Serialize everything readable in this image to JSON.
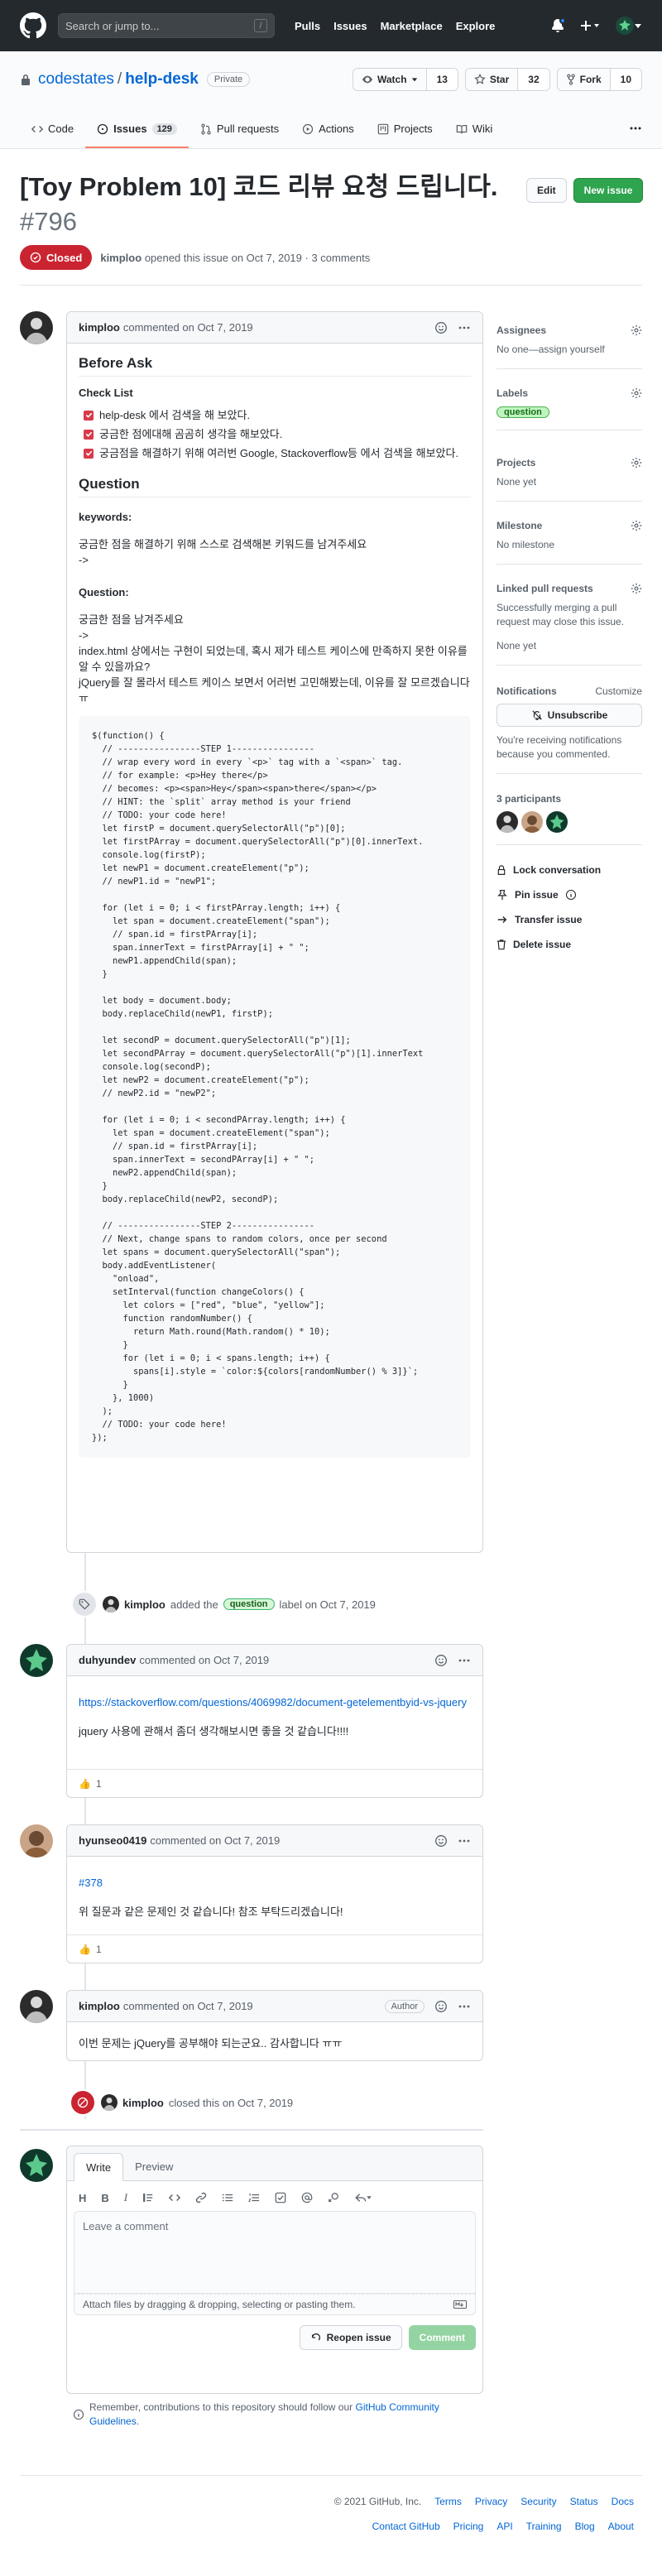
{
  "topbar": {
    "search_placeholder": "Search or jump to...",
    "search_shortcut": "/",
    "nav": [
      "Pulls",
      "Issues",
      "Marketplace",
      "Explore"
    ]
  },
  "repo": {
    "owner": "codestates",
    "separator": "/",
    "name": "help-desk",
    "visibility": "Private",
    "watch_label": "Watch",
    "watch_count": "13",
    "star_label": "Star",
    "star_count": "32",
    "fork_label": "Fork",
    "fork_count": "10",
    "tabs": [
      {
        "label": "Code",
        "icon": "code-icon"
      },
      {
        "label": "Issues",
        "icon": "issue-icon",
        "count": "129",
        "active": true
      },
      {
        "label": "Pull requests",
        "icon": "pull-request-icon"
      },
      {
        "label": "Actions",
        "icon": "play-icon"
      },
      {
        "label": "Projects",
        "icon": "project-icon"
      },
      {
        "label": "Wiki",
        "icon": "book-icon"
      }
    ]
  },
  "issue": {
    "title": "[Toy Problem 10] 코드 리뷰 요청 드립니다.",
    "number": "#796",
    "edit_label": "Edit",
    "new_issue_label": "New issue",
    "status": "Closed",
    "author": "kimploo",
    "opened_text": "opened this issue on Oct 7, 2019 · 3 comments"
  },
  "comments": {
    "c1": {
      "author": "kimploo",
      "meta": "commented on Oct 7, 2019",
      "h_before": "Before Ask",
      "h_checklist": "Check List",
      "tasks": [
        "help-desk 에서 검색을 해 보았다.",
        "궁금한 점에대해 곰곰히 생각을 해보았다.",
        "궁금점을 해결하기 위해 여러번 Google, Stackoverflow등 에서 검색을 해보았다."
      ],
      "h_question": "Question",
      "keywords_label": "keywords:",
      "keywords_text": "궁금한 점을 해결하기 위해 스스로 검색해본 키워드를 남겨주세요",
      "keywords_arrow": "->",
      "question_label": "Question:",
      "question_text": "궁금한 점을 남겨주세요",
      "question_arrow": "->",
      "question_body": "index.html 상에서는 구현이 되었는데, 혹시 제가 테스트 케이스에 만족하지 못한 이유를 알 수 있을까요?",
      "question_body2": "jQuery를 잘 몰라서 테스트 케이스 보면서 어러번 고민해봤는데, 이유를 잘 모르겠습니다 ㅠ",
      "code": "$(function() {\n  // ----------------STEP 1----------------\n  // wrap every word in every `<p>` tag with a `<span>` tag.\n  // for example: <p>Hey there</p>\n  // becomes: <p><span>Hey</span><span>there</span></p>\n  // HINT: the `split` array method is your friend\n  // TODO: your code here!\n  let firstP = document.querySelectorAll(\"p\")[0];\n  let firstPArray = document.querySelectorAll(\"p\")[0].innerText.\n  console.log(firstP);\n  let newP1 = document.createElement(\"p\");\n  // newP1.id = \"newP1\";\n\n  for (let i = 0; i < firstPArray.length; i++) {\n    let span = document.createElement(\"span\");\n    // span.id = firstPArray[i];\n    span.innerText = firstPArray[i] + \" \";\n    newP1.appendChild(span);\n  }\n\n  let body = document.body;\n  body.replaceChild(newP1, firstP);\n\n  let secondP = document.querySelectorAll(\"p\")[1];\n  let secondPArray = document.querySelectorAll(\"p\")[1].innerText\n  console.log(secondP);\n  let newP2 = document.createElement(\"p\");\n  // newP2.id = \"newP2\";\n\n  for (let i = 0; i < secondPArray.length; i++) {\n    let span = document.createElement(\"span\");\n    // span.id = firstPArray[i];\n    span.innerText = secondPArray[i] + \" \";\n    newP2.appendChild(span);\n  }\n  body.replaceChild(newP2, secondP);\n\n  // ----------------STEP 2----------------\n  // Next, change spans to random colors, once per second\n  let spans = document.querySelectorAll(\"span\");\n  body.addEventListener(\n    \"onload\",\n    setInterval(function changeColors() {\n      let colors = [\"red\", \"blue\", \"yellow\"];\n      function randomNumber() {\n        return Math.round(Math.random() * 10);\n      }\n      for (let i = 0; i < spans.length; i++) {\n        spans[i].style = `color:${colors[randomNumber() % 3]}`;\n      }\n    }, 1000)\n  );\n  // TODO: your code here!\n});"
    },
    "event_label": {
      "actor": "kimploo",
      "text1": "added the",
      "label": "question",
      "text2": "label on Oct 7, 2019"
    },
    "c2": {
      "author": "duhyundev",
      "meta": "commented on Oct 7, 2019",
      "link": "https://stackoverflow.com/questions/4069982/document-getelementbyid-vs-jquery",
      "body": "jquery 사용에 관해서 좀더 생각해보시면 좋을 것 같습니다!!!!",
      "reaction_count": "1"
    },
    "c3": {
      "author": "hyunseo0419",
      "meta": "commented on Oct 7, 2019",
      "link": "#378",
      "body": "위 질문과 같은 문제인 것 같습니다! 참조 부탁드리겠습니다!",
      "reaction_count": "1"
    },
    "c4": {
      "author": "kimploo",
      "meta": "commented on Oct 7, 2019",
      "badge": "Author",
      "body": "이번 문제는 jQuery를 공부해야 되는군요.. 감사합니다 ㅠㅠ"
    },
    "event_closed": {
      "actor": "kimploo",
      "text": "closed this on Oct 7, 2019"
    }
  },
  "sidebar": {
    "assignees_title": "Assignees",
    "assignees_value": "No one—assign yourself",
    "labels_title": "Labels",
    "label": "question",
    "projects_title": "Projects",
    "projects_value": "None yet",
    "milestone_title": "Milestone",
    "milestone_value": "No milestone",
    "linked_title": "Linked pull requests",
    "linked_value": "Successfully merging a pull request may close this issue.",
    "linked_value2": "None yet",
    "notifications_title": "Notifications",
    "customize": "Customize",
    "unsubscribe": "Unsubscribe",
    "notif_reason": "You're receiving notifications because you commented.",
    "participants_title": "3 participants",
    "lock": "Lock conversation",
    "pin": "Pin issue",
    "transfer": "Transfer issue",
    "delete": "Delete issue"
  },
  "reply": {
    "tab_write": "Write",
    "tab_preview": "Preview",
    "toolbar_h": "H",
    "toolbar_b": "B",
    "toolbar_i": "I",
    "placeholder": "Leave a comment",
    "attach": "Attach files by dragging & dropping, selecting or pasting them.",
    "reopen": "Reopen issue",
    "comment": "Comment",
    "contrib_pre": "Remember, contributions to this repository should follow our",
    "contrib_link": "GitHub Community Guidelines",
    "contrib_post": "."
  },
  "footer": {
    "copyright": "© 2021 GitHub, Inc.",
    "row1": [
      "Terms",
      "Privacy",
      "Security",
      "Status",
      "Docs"
    ],
    "row2": [
      "Contact GitHub",
      "Pricing",
      "API",
      "Training",
      "Blog",
      "About"
    ]
  },
  "colors": {
    "topbar": "#24292e",
    "closed": "#cb2431",
    "new_issue": "#2ea44f",
    "link": "#0366d6",
    "tab_underline": "#f9826c"
  }
}
